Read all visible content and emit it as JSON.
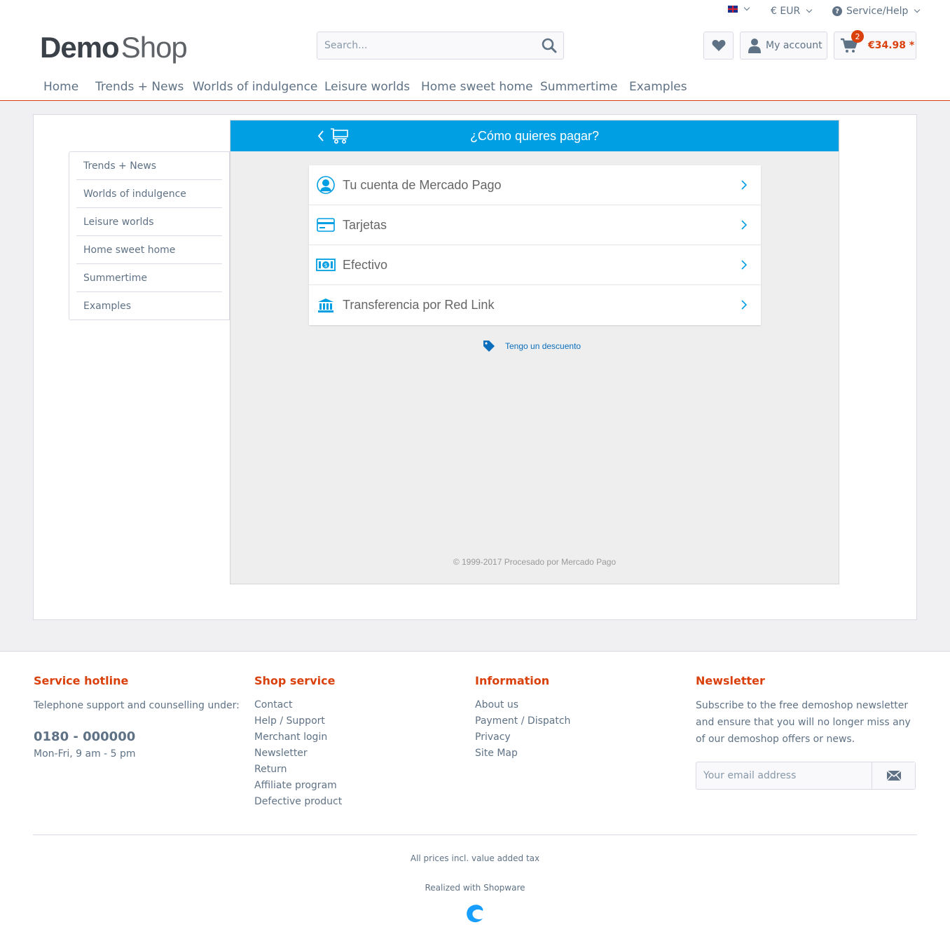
{
  "topbar": {
    "language_icon": "uk-flag-icon",
    "currency": "€ EUR",
    "service": "Service/Help"
  },
  "header": {
    "logo_bold": "Demo",
    "logo_light": "Shop",
    "search_placeholder": "Search...",
    "account_label": "My account",
    "cart_count": "2",
    "cart_total": "€34.98 *"
  },
  "nav": {
    "items": [
      "Home",
      "Trends + News",
      "Worlds of indulgence",
      "Leisure worlds",
      "Home sweet home",
      "Summertime",
      "Examples"
    ]
  },
  "sidebar": {
    "items": [
      "Trends + News",
      "Worlds of indulgence",
      "Leisure worlds",
      "Home sweet home",
      "Summertime",
      "Examples"
    ]
  },
  "payment": {
    "title": "¿Cómo quieres pagar?",
    "options": [
      "Tu cuenta de Mercado Pago",
      "Tarjetas",
      "Efectivo",
      "Transferencia por Red Link"
    ],
    "discount": "Tengo un descuento",
    "copyright": "© 1999-2017 Procesado por Mercado Pago",
    "accent": "#009ee3"
  },
  "footer": {
    "hotline": {
      "title": "Service hotline",
      "text": "Telephone support and counselling under:",
      "phone": "0180 - 000000",
      "hours": "Mon-Fri, 9 am - 5 pm"
    },
    "shop_service": {
      "title": "Shop service",
      "links": [
        "Contact",
        "Help / Support",
        "Merchant login",
        "Newsletter",
        "Return",
        "Affiliate program",
        "Defective product"
      ]
    },
    "information": {
      "title": "Information",
      "links": [
        "About us",
        "Payment / Dispatch",
        "Privacy",
        "Site Map"
      ]
    },
    "newsletter": {
      "title": "Newsletter",
      "text": "Subscribe to the free demoshop newsletter and ensure that you will no longer miss any of our demoshop offers or news.",
      "placeholder": "Your email address"
    },
    "tax_note": "All prices incl. value added tax",
    "realized": "Realized with Shopware"
  },
  "colors": {
    "brand": "#d9400b",
    "text": "#5f7285"
  }
}
